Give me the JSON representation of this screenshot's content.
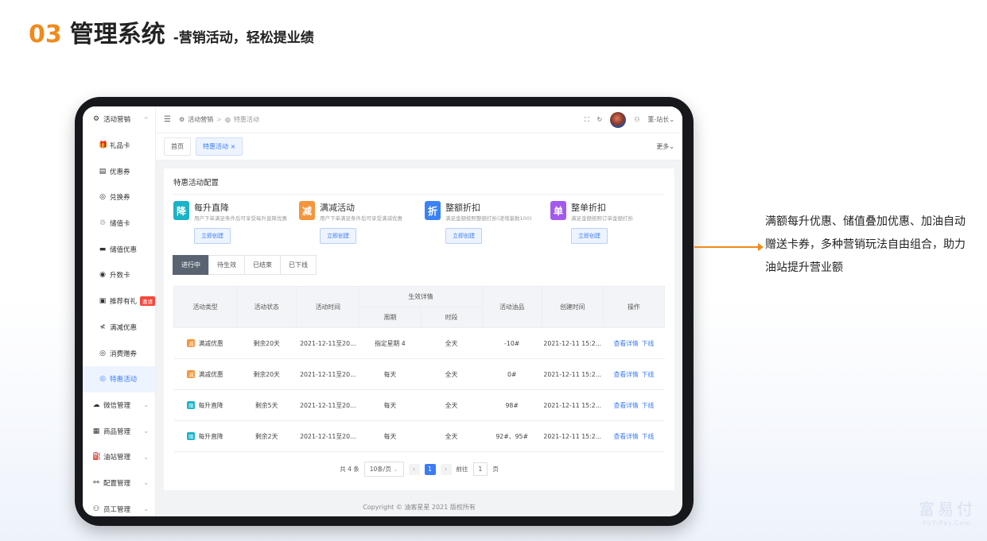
{
  "slide": {
    "number": "03",
    "title": "管理系统",
    "subtitle": "-营销活动，轻松提业绩"
  },
  "sidebar": {
    "items": [
      {
        "label": "活动营销",
        "icon": "⚙",
        "chevron": "^"
      },
      {
        "label": "礼品卡",
        "icon": "🎁"
      },
      {
        "label": "优惠券",
        "icon": "▤"
      },
      {
        "label": "兑换券",
        "icon": "◎"
      },
      {
        "label": "储值卡",
        "icon": "♲"
      },
      {
        "label": "储值优惠",
        "icon": "▬"
      },
      {
        "label": "升数卡",
        "icon": "◉"
      },
      {
        "label": "推荐有礼",
        "icon": "▣",
        "badge": "邀请"
      },
      {
        "label": "满减优惠",
        "icon": "≮"
      },
      {
        "label": "消费赠券",
        "icon": "◎"
      },
      {
        "label": "特惠活动",
        "icon": "◎"
      },
      {
        "label": "微信管理",
        "icon": "☁",
        "chevron": "⌄"
      },
      {
        "label": "商品管理",
        "icon": "▦",
        "chevron": "⌄"
      },
      {
        "label": "油站管理",
        "icon": "⛽",
        "chevron": "⌄"
      },
      {
        "label": "配置管理",
        "icon": "⚯",
        "chevron": "⌄"
      },
      {
        "label": "员工管理",
        "icon": "⚇",
        "chevron": "⌄"
      }
    ]
  },
  "topbar": {
    "menu_icon": "☰",
    "crumb1": "活动营销",
    "crumb_sep": ">",
    "crumb2": "特惠活动",
    "fullscreen_icon": "⛶",
    "refresh_icon": "↻",
    "user": "董-站长",
    "user_chevron": "⌄"
  },
  "tabs": {
    "home": "首页",
    "current": "特惠活动",
    "close": "×",
    "more": "更多⌄"
  },
  "config": {
    "title": "特惠活动配置",
    "cards": [
      {
        "icon": "降",
        "color": "#1ab3c7",
        "name": "每升直降",
        "desc": "用户下单满足条件后可享受每升直降优惠",
        "button": "立即创建"
      },
      {
        "icon": "减",
        "color": "#f5953b",
        "name": "满减活动",
        "desc": "用户下单满足条件后可享受满减优惠",
        "button": "立即创建"
      },
      {
        "icon": "折",
        "color": "#3b82f6",
        "name": "整额折扣",
        "desc": "满足金额按照整额打折(递增基数100)",
        "button": "立即创建"
      },
      {
        "icon": "单",
        "color": "#a259f0",
        "name": "整单折扣",
        "desc": "满足金额按照订单金额打折",
        "button": "立即创建"
      }
    ]
  },
  "status_tabs": [
    "进行中",
    "待生效",
    "已结束",
    "已下线"
  ],
  "table": {
    "headers": {
      "type": "活动类型",
      "status": "活动状态",
      "time": "活动时间",
      "effective": "生效详情",
      "period": "周期",
      "slot": "时段",
      "products": "活动油品",
      "created": "创建时间",
      "ops": "操作"
    },
    "rows": [
      {
        "icon": "减",
        "icon_color": "#f5953b",
        "type": "满减优惠",
        "status": "剩余20天",
        "time": "2021-12-11至20...",
        "period": "指定星期 4",
        "slot": "全天",
        "products": "-10#",
        "created": "2021-12-11 15:2...",
        "op1": "查看详情",
        "op2": "下线"
      },
      {
        "icon": "减",
        "icon_color": "#f5953b",
        "type": "满减优惠",
        "status": "剩余20天",
        "time": "2021-12-11至20...",
        "period": "每天",
        "slot": "全天",
        "products": "0#",
        "created": "2021-12-11 15:2...",
        "op1": "查看详情",
        "op2": "下线"
      },
      {
        "icon": "降",
        "icon_color": "#1ab3c7",
        "type": "每升直降",
        "status": "剩余5天",
        "time": "2021-12-11至20...",
        "period": "每天",
        "slot": "全天",
        "products": "98#",
        "created": "2021-12-11 15:2...",
        "op1": "查看详情",
        "op2": "下线"
      },
      {
        "icon": "降",
        "icon_color": "#1ab3c7",
        "type": "每升直降",
        "status": "剩余2天",
        "time": "2021-12-11至20...",
        "period": "每天",
        "slot": "全天",
        "products": "92#、95#",
        "created": "2021-12-11 15:2...",
        "op1": "查看详情",
        "op2": "下线"
      }
    ]
  },
  "pager": {
    "total": "共 4 条",
    "page_size": "10条/页",
    "select_chevron": "⌄",
    "prev": "‹",
    "current": "1",
    "next": "›",
    "goto": "前往",
    "goto_value": "1",
    "page_unit": "页"
  },
  "footer": {
    "copyright": "Copyright © 油客星星 2021 版权所有"
  },
  "callout": {
    "text": "满额每升优惠、储值叠加优惠、加油自动赠送卡券，多种营销玩法自由组合，助力油站提升营业额"
  },
  "watermark": {
    "main": "富易付",
    "sub": "FuYiPay.Com"
  }
}
